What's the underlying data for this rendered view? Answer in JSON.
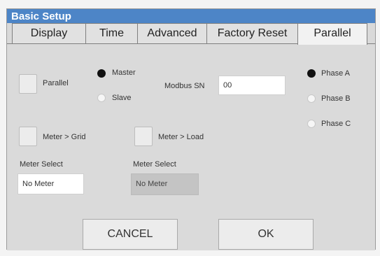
{
  "window": {
    "title": "Basic Setup"
  },
  "tabs": [
    {
      "label": "Display"
    },
    {
      "label": "Time"
    },
    {
      "label": "Advanced"
    },
    {
      "label": "Factory Reset"
    },
    {
      "label": "Parallel",
      "active": true
    }
  ],
  "parallel": {
    "parallel_label": "Parallel",
    "master_label": "Master",
    "slave_label": "Slave",
    "mode_selected": "Master",
    "modbus_label": "Modbus SN",
    "modbus_value": "00",
    "phase_a_label": "Phase A",
    "phase_b_label": "Phase B",
    "phase_c_label": "Phase C",
    "phase_selected": "Phase A",
    "meter_grid_label": "Meter > Grid",
    "meter_load_label": "Meter > Load",
    "meter_select_1_label": "Meter Select",
    "meter_select_1_value": "No Meter",
    "meter_select_2_label": "Meter Select",
    "meter_select_2_value": "No Meter"
  },
  "buttons": {
    "cancel": "CANCEL",
    "ok": "OK"
  },
  "colors": {
    "titlebar": "#4d85c7",
    "panel": "#dadada",
    "disabled_field": "#c4c4c4"
  }
}
